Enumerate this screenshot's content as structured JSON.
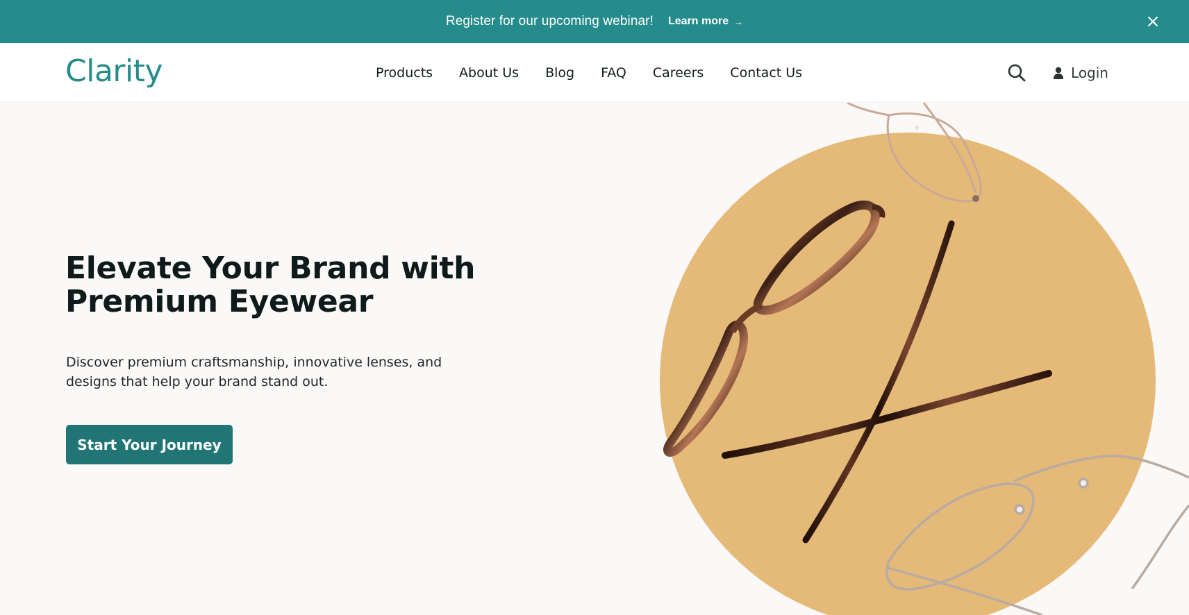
{
  "announcement": {
    "text": "Register for our upcoming webinar!",
    "link_label": "Learn more",
    "link_icon": "arrow-right-icon",
    "close_icon": "close-icon"
  },
  "header": {
    "logo": "Clarity",
    "nav": [
      {
        "label": "Products"
      },
      {
        "label": "About Us"
      },
      {
        "label": "Blog"
      },
      {
        "label": "FAQ"
      },
      {
        "label": "Careers"
      },
      {
        "label": "Contact Us"
      }
    ],
    "search_icon": "search-icon",
    "login": {
      "label": "Login",
      "icon": "user-icon"
    }
  },
  "hero": {
    "title_line1": "Elevate Your Brand with",
    "title_line2": "Premium Eyewear",
    "desc_line1": "Discover premium craftsmanship, innovative lenses, and",
    "desc_line2": "designs that help your brand stand out.",
    "cta_label": "Start Your Journey",
    "image": "eyeglasses-on-circle-illustration"
  },
  "colors": {
    "brand_teal": "#258b8b",
    "button_teal": "#217575",
    "hero_background": "#faf9f7",
    "circle_accent": "#e5b978",
    "tortoise_dark": "#3a1f14",
    "tortoise_light": "#a8684a"
  }
}
